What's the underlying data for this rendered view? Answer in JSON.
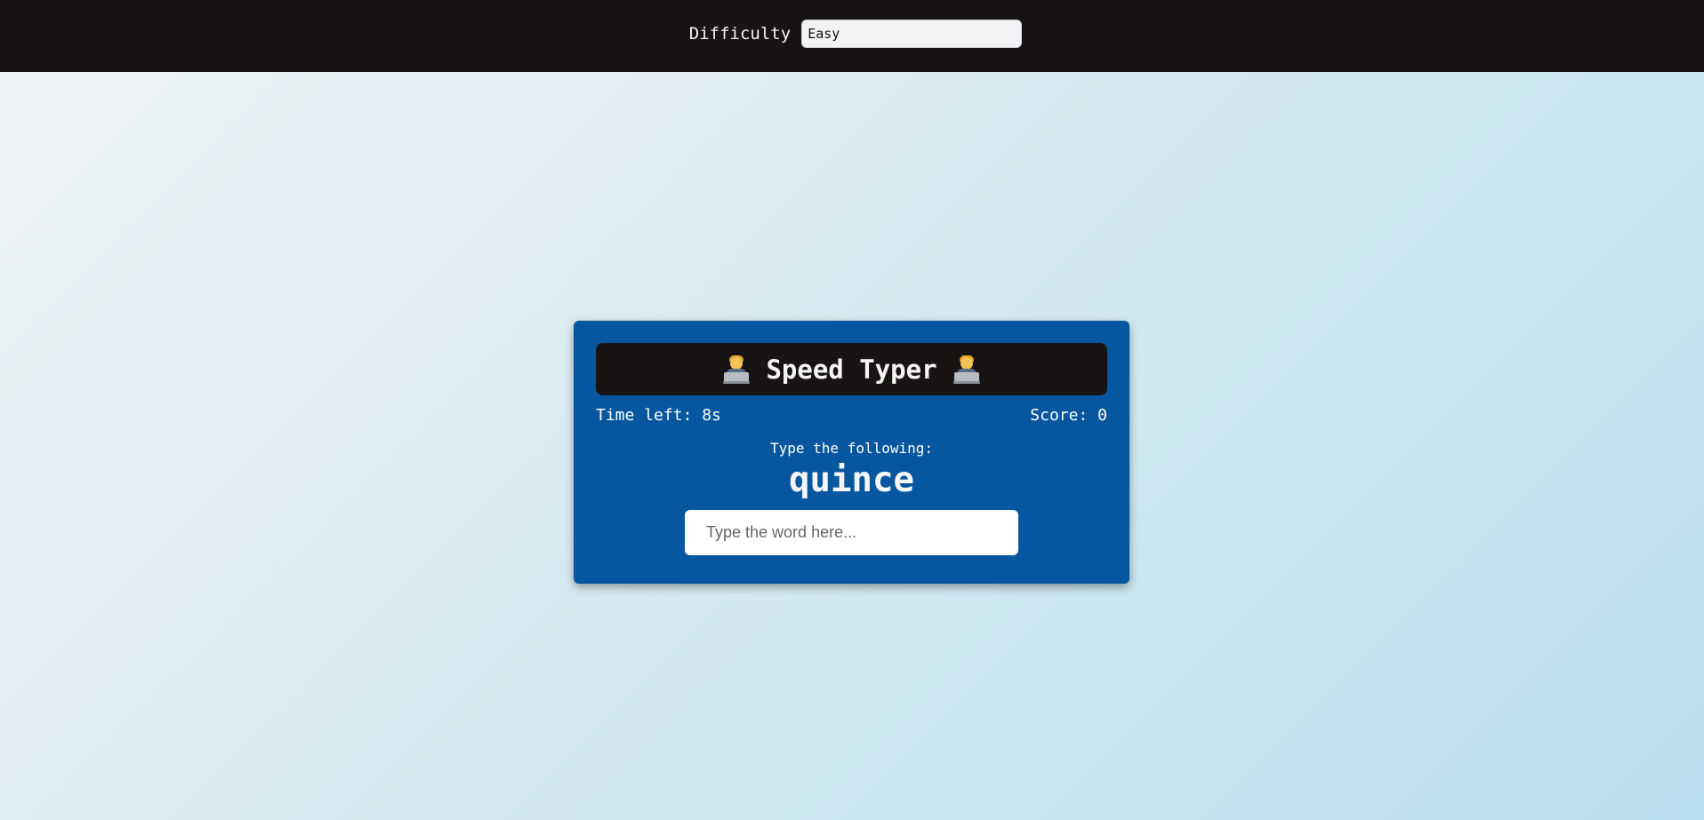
{
  "header": {
    "difficulty_label": "Difficulty",
    "difficulty_value": "Easy"
  },
  "game": {
    "title": "Speed Typer",
    "title_icon": "technologist-emoji",
    "time_left_label": "Time left: 8s",
    "time_left_seconds": 8,
    "score_label": "Score: 0",
    "score": 0,
    "prompt": "Type the following:",
    "word": "quince",
    "input_value": "",
    "input_placeholder": "Type the word here..."
  },
  "colors": {
    "header_bg": "#191414",
    "card_bg": "#0657a0",
    "title_bar_bg": "#191414",
    "text": "#ffffff"
  }
}
